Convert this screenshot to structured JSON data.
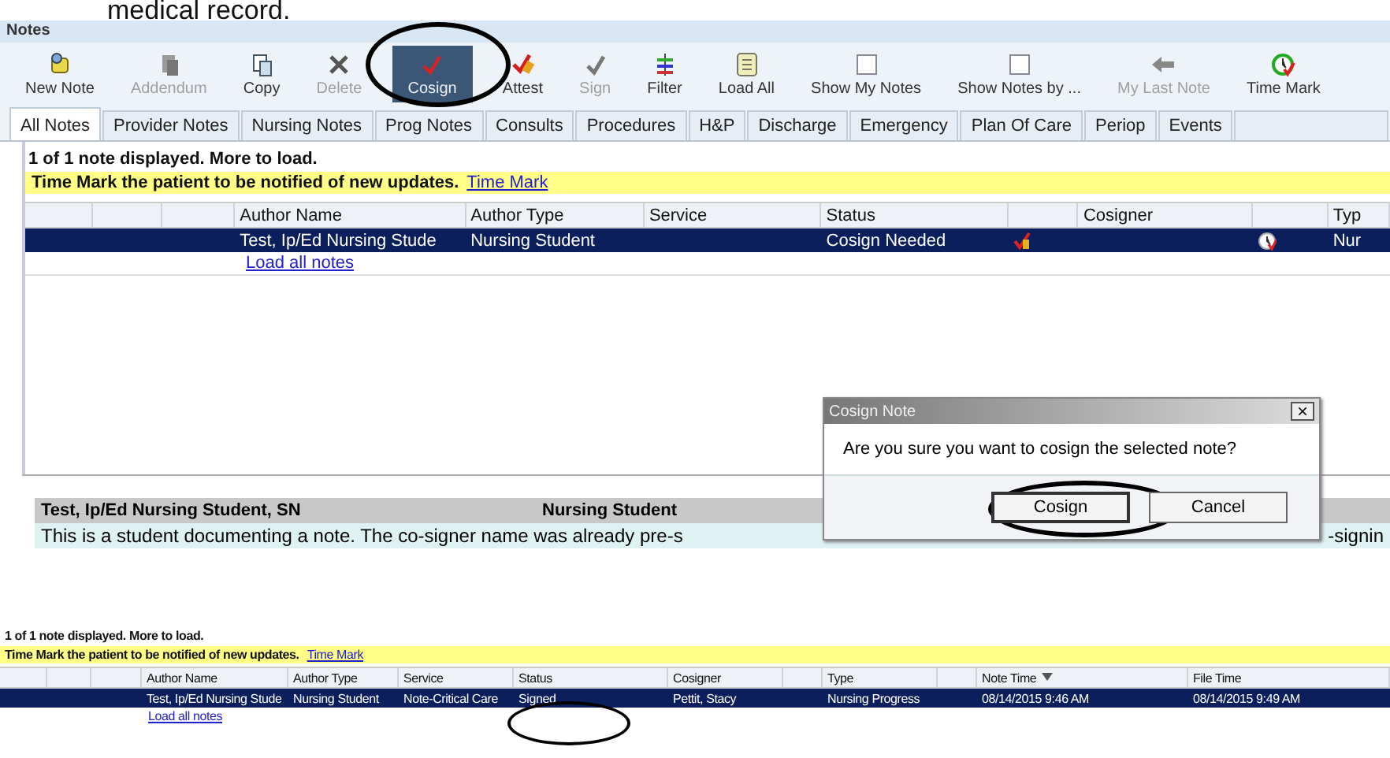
{
  "caption": "medical record.",
  "window": {
    "title": "Notes"
  },
  "toolbar": [
    {
      "label": "New Note",
      "disabled": false,
      "selected": false
    },
    {
      "label": "Addendum",
      "disabled": true,
      "selected": false
    },
    {
      "label": "Copy",
      "disabled": false,
      "selected": false
    },
    {
      "label": "Delete",
      "disabled": true,
      "selected": false
    },
    {
      "label": "Cosign",
      "disabled": false,
      "selected": true
    },
    {
      "label": "Attest",
      "disabled": false,
      "selected": false
    },
    {
      "label": "Sign",
      "disabled": true,
      "selected": false
    },
    {
      "label": "Filter",
      "disabled": false,
      "selected": false
    },
    {
      "label": "Load All",
      "disabled": false,
      "selected": false
    },
    {
      "label": "Show My Notes",
      "disabled": false,
      "selected": false
    },
    {
      "label": "Show Notes by ...",
      "disabled": false,
      "selected": false
    },
    {
      "label": "My Last Note",
      "disabled": true,
      "selected": false
    },
    {
      "label": "Time Mark",
      "disabled": false,
      "selected": false
    }
  ],
  "tabs": [
    {
      "label": "All Notes",
      "selected": true
    },
    {
      "label": "Provider Notes",
      "selected": false
    },
    {
      "label": "Nursing Notes",
      "selected": false
    },
    {
      "label": "Prog Notes",
      "selected": false
    },
    {
      "label": "Consults",
      "selected": false
    },
    {
      "label": "Procedures",
      "selected": false
    },
    {
      "label": "H&P",
      "selected": false
    },
    {
      "label": "Discharge",
      "selected": false
    },
    {
      "label": "Emergency",
      "selected": false
    },
    {
      "label": "Plan Of Care",
      "selected": false
    },
    {
      "label": "Periop",
      "selected": false
    },
    {
      "label": "Events",
      "selected": false
    }
  ],
  "notes_list": {
    "status": "1 of 1 note displayed. More to load.",
    "banner": {
      "text": "Time Mark the patient to be notified of new updates.",
      "link": "Time Mark"
    },
    "columns": [
      "",
      "",
      "",
      "Author Name",
      "Author Type",
      "Service",
      "Status",
      "",
      "Cosigner",
      "",
      "Typ"
    ],
    "rows": [
      {
        "selected": true,
        "cells": [
          "",
          "",
          "",
          "Test, Ip/Ed Nursing Stude",
          "Nursing Student",
          "",
          "Cosign Needed",
          "",
          "",
          "",
          "Nur"
        ]
      }
    ],
    "load_link": "Load all notes"
  },
  "preview": {
    "author": "Test, Ip/Ed Nursing Student, SN",
    "author_type": "Nursing Student",
    "text_left": "This is a student documenting a note.  The co-signer name was already pre-s",
    "text_right": "-signin"
  },
  "dialog": {
    "title": "Cosign Note",
    "close": "×",
    "message": "Are you sure you want to cosign the selected note?",
    "buttons": [
      "Cosign",
      "Cancel"
    ]
  },
  "after_list": {
    "status": "1 of 1 note displayed. More to load.",
    "banner": {
      "text": "Time Mark the patient to be notified of new updates.",
      "link": "Time Mark"
    },
    "columns": [
      "",
      "",
      "",
      "Author Name",
      "Author Type",
      "Service",
      "Status",
      "Cosigner",
      "",
      "Type",
      "",
      "Note Time",
      "File Time"
    ],
    "rows": [
      {
        "selected": true,
        "cells": [
          "",
          "",
          "",
          "Test, Ip/Ed Nursing Stude",
          "Nursing Student",
          "Note-Critical Care",
          "Signed",
          "Pettit, Stacy",
          "",
          "Nursing Progress",
          "",
          "08/14/2015 9:46 AM",
          "08/14/2015 9:49 AM"
        ]
      }
    ],
    "load_link": "Load all notes"
  }
}
